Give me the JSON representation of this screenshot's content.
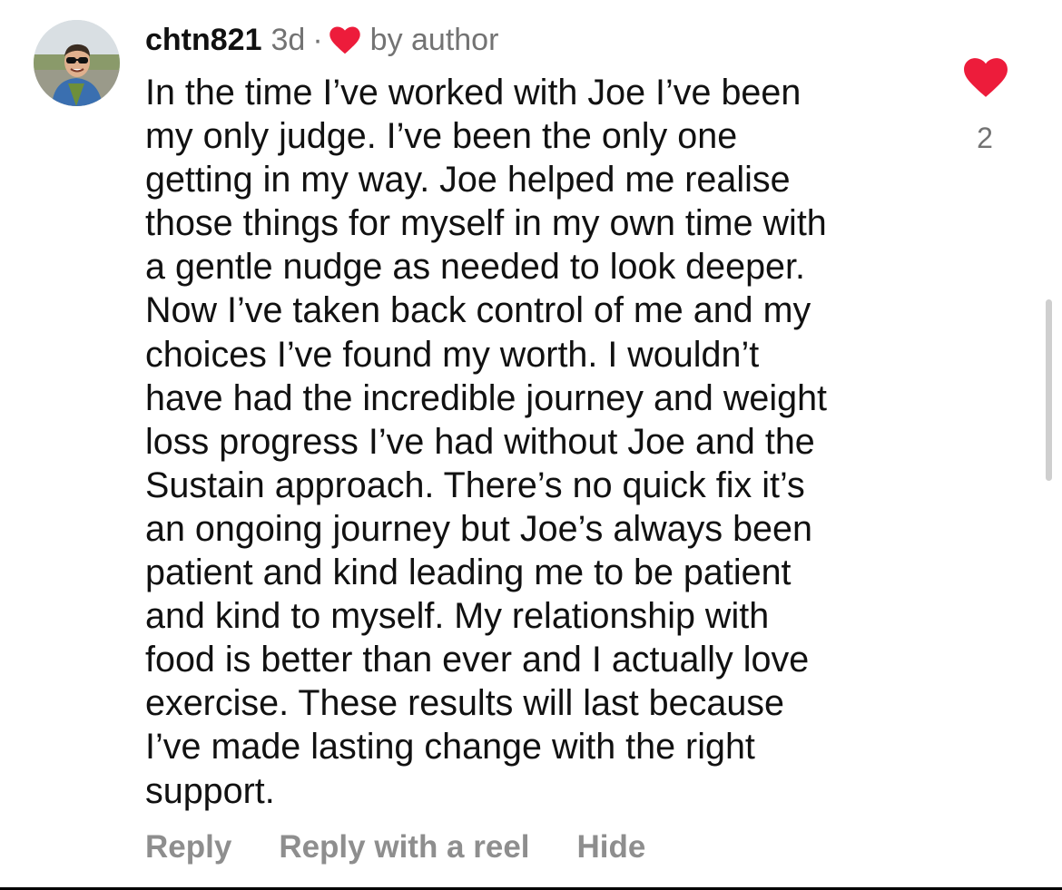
{
  "comment": {
    "username": "chtn821",
    "time": "3d",
    "separator": "·",
    "author_badge": "by author",
    "author_badge_icon": "heart-icon",
    "text": "In the time I’ve worked with Joe I’ve been\nmy only judge. I’ve been the only one\ngetting in my way. Joe helped me realise\nthose things for myself in my own time with\na gentle nudge as needed to look deeper.\nNow I’ve taken back control of me and my\nchoices I’ve found my worth. I wouldn’t\nhave had the incredible journey and weight\nloss progress I’ve had without Joe and the\nSustain approach. There’s no quick fix it’s\nan ongoing journey but Joe’s always been\npatient and kind leading me to be patient\nand kind to myself. My relationship with\nfood is better than ever and I actually love\nexercise. These results will last because\nI’ve made lasting change with the right\nsupport.",
    "like_count": "2",
    "liked": true
  },
  "actions": {
    "reply": "Reply",
    "reply_with_reel": "Reply with a reel",
    "hide": "Hide"
  },
  "colors": {
    "heart": "#ed1c3b",
    "secondary_text": "#737373",
    "action_text": "#8e8e8e"
  }
}
